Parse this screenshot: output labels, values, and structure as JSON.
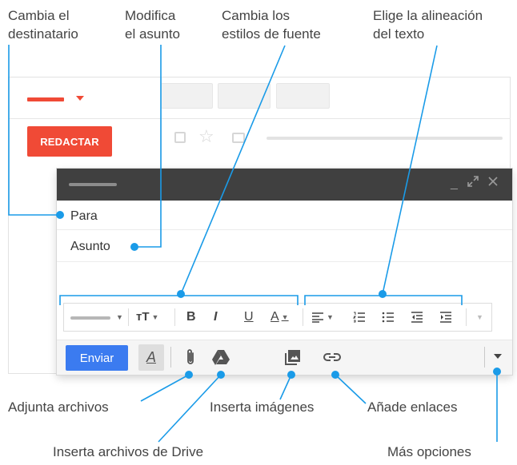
{
  "labels": {
    "change_recipient": [
      "Cambia el",
      "destinatario"
    ],
    "edit_subject": [
      "Modifica",
      "el asunto"
    ],
    "change_font": [
      "Cambia los",
      "estilos de fuente"
    ],
    "align_text": [
      "Elige la alineación",
      "del texto"
    ],
    "attach_files": "Adjunta archivos",
    "insert_images": "Inserta imágenes",
    "add_links": "Añade enlaces",
    "insert_drive": "Inserta archivos de Drive",
    "more_options": "Más opciones"
  },
  "gmail": {
    "compose_button": "REDACTAR",
    "to_field": "Para",
    "subject_field": "Asunto",
    "send_button": "Enviar",
    "format_button": "A"
  },
  "toolbar": {
    "bold": "B",
    "italic": "I",
    "underline": "U",
    "text_color": "A",
    "text_size": "тT"
  },
  "colors": {
    "accent_red": "#f04a36",
    "send_blue": "#3b7bf0",
    "callout_blue": "#1a9be8",
    "title_bar": "#404040"
  },
  "icons": [
    "attach-icon",
    "drive-icon",
    "image-icon",
    "link-icon",
    "align-icon",
    "numbered-list-icon",
    "bullet-list-icon",
    "indent-less-icon",
    "indent-more-icon",
    "minimize-icon",
    "expand-icon",
    "close-icon",
    "star-icon",
    "chevron-down-icon"
  ]
}
